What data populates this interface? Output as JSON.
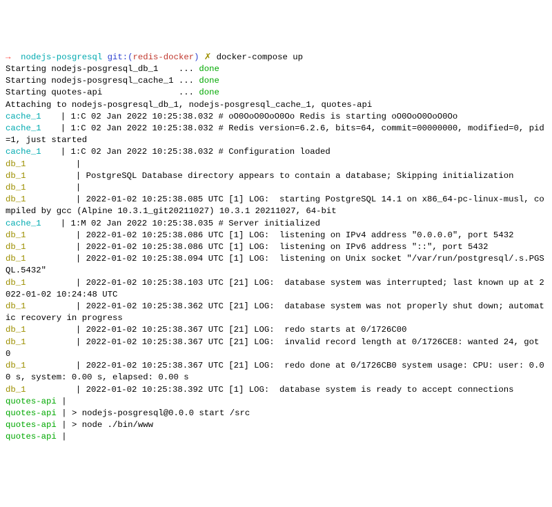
{
  "prompt": {
    "arrow": "→",
    "dir": "nodejs-posgresql",
    "git_label": "git:(",
    "branch": "redis-docker",
    "git_close": ")",
    "dirty": "✗",
    "command": "docker-compose up"
  },
  "lines": [
    {
      "raw": "Starting nodejs-posgresql_db_1    ... ",
      "status": "done"
    },
    {
      "raw": "Starting nodejs-posgresql_cache_1 ... ",
      "status": "done"
    },
    {
      "raw": "Starting quotes-api               ... ",
      "status": "done"
    },
    {
      "raw": "Attaching to nodejs-posgresql_db_1, nodejs-posgresql_cache_1, quotes-api"
    },
    {
      "label": "cache_1",
      "color": "cyan",
      "text": "| 1:C 02 Jan 2022 10:25:38.032 # oO0OoO0OoO0Oo Redis is starting oO0OoO0OoO0Oo"
    },
    {
      "label": "cache_1",
      "color": "cyan",
      "text": "| 1:C 02 Jan 2022 10:25:38.032 # Redis version=6.2.6, bits=64, commit=00000000, modified=0, pid=1, just started"
    },
    {
      "label": "cache_1",
      "color": "cyan",
      "text": "| 1:C 02 Jan 2022 10:25:38.032 # Configuration loaded"
    },
    {
      "label": "db_1",
      "color": "yellow",
      "text": "| "
    },
    {
      "label": "db_1",
      "color": "yellow",
      "text": "| PostgreSQL Database directory appears to contain a database; Skipping initialization"
    },
    {
      "label": "db_1",
      "color": "yellow",
      "text": "| "
    },
    {
      "label": "db_1",
      "color": "yellow",
      "text": "| 2022-01-02 10:25:38.085 UTC [1] LOG:  starting PostgreSQL 14.1 on x86_64-pc-linux-musl, compiled by gcc (Alpine 10.3.1_git20211027) 10.3.1 20211027, 64-bit"
    },
    {
      "label": "cache_1",
      "color": "cyan",
      "text": "| 1:M 02 Jan 2022 10:25:38.035 # Server initialized"
    },
    {
      "label": "db_1",
      "color": "yellow",
      "text": "| 2022-01-02 10:25:38.086 UTC [1] LOG:  listening on IPv4 address \"0.0.0.0\", port 5432"
    },
    {
      "label": "db_1",
      "color": "yellow",
      "text": "| 2022-01-02 10:25:38.086 UTC [1] LOG:  listening on IPv6 address \"::\", port 5432"
    },
    {
      "label": "db_1",
      "color": "yellow",
      "text": "| 2022-01-02 10:25:38.094 UTC [1] LOG:  listening on Unix socket \"/var/run/postgresql/.s.PGSQL.5432\""
    },
    {
      "label": "db_1",
      "color": "yellow",
      "text": "| 2022-01-02 10:25:38.103 UTC [21] LOG:  database system was interrupted; last known up at 2022-01-02 10:24:48 UTC"
    },
    {
      "label": "db_1",
      "color": "yellow",
      "text": "| 2022-01-02 10:25:38.362 UTC [21] LOG:  database system was not properly shut down; automatic recovery in progress"
    },
    {
      "label": "db_1",
      "color": "yellow",
      "text": "| 2022-01-02 10:25:38.367 UTC [21] LOG:  redo starts at 0/1726C00"
    },
    {
      "label": "db_1",
      "color": "yellow",
      "text": "| 2022-01-02 10:25:38.367 UTC [21] LOG:  invalid record length at 0/1726CE8: wanted 24, got 0"
    },
    {
      "label": "db_1",
      "color": "yellow",
      "text": "| 2022-01-02 10:25:38.367 UTC [21] LOG:  redo done at 0/1726CB0 system usage: CPU: user: 0.00 s, system: 0.00 s, elapsed: 0.00 s"
    },
    {
      "label": "db_1",
      "color": "yellow",
      "text": "| 2022-01-02 10:25:38.392 UTC [1] LOG:  database system is ready to accept connections"
    },
    {
      "label": "quotes-api",
      "color": "green",
      "text": "| "
    },
    {
      "label": "quotes-api",
      "color": "green",
      "text": "| > nodejs-posgresql@0.0.0 start /src"
    },
    {
      "label": "quotes-api",
      "color": "green",
      "text": "| > node ./bin/www"
    },
    {
      "label": "quotes-api",
      "color": "green",
      "text": "| "
    }
  ]
}
